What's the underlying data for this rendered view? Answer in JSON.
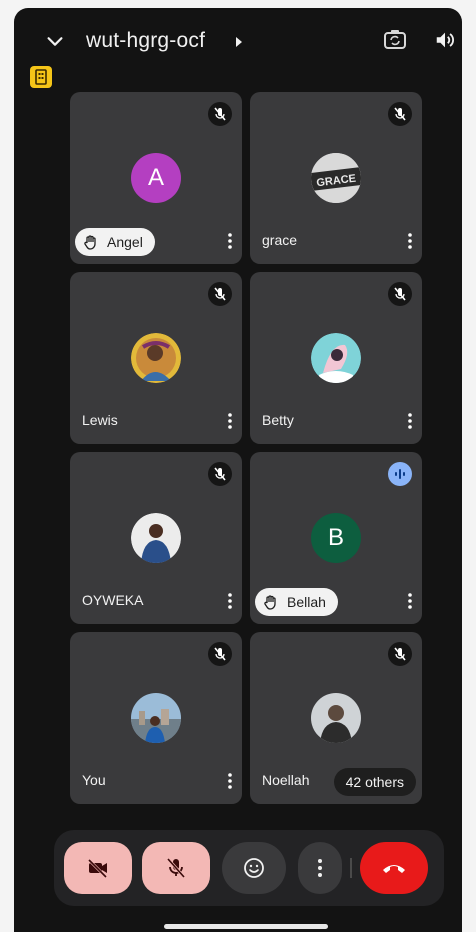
{
  "header": {
    "meeting_code": "wut-hgrg-ocf",
    "icons": [
      "chevron-down-icon",
      "chevron-right-icon",
      "switch-camera-icon",
      "speaker-icon"
    ]
  },
  "tiles": [
    {
      "name": "Angel",
      "avatar_letter": "A",
      "hand_raised": true,
      "muted": true
    },
    {
      "name": "grace",
      "avatar_image_text": "GRACE",
      "hand_raised": false,
      "muted": true
    },
    {
      "name": "Lewis",
      "hand_raised": false,
      "muted": true
    },
    {
      "name": "Betty",
      "hand_raised": false,
      "muted": true
    },
    {
      "name": "OYWEKA",
      "hand_raised": false,
      "muted": true
    },
    {
      "name": "Bellah",
      "avatar_letter": "B",
      "hand_raised": true,
      "muted": false,
      "speaking": true
    },
    {
      "name": "You",
      "hand_raised": false,
      "muted": true
    },
    {
      "name": "Noellah",
      "others_label": "42 others",
      "hand_raised": false,
      "muted": true
    }
  ],
  "controls": {
    "icons": [
      "camera-off-icon",
      "mic-off-icon",
      "emoji-icon",
      "more-vert-icon",
      "end-call-icon"
    ]
  },
  "colors": {
    "background": "#131313",
    "tile": "#3a3a3c",
    "control_off": "#f3b8b5",
    "end_call": "#e81a1a",
    "speaking": "#8ab4f8",
    "avatar_a": "#b43fc1",
    "avatar_b": "#0d5e3f",
    "badge": "#f5c518"
  }
}
